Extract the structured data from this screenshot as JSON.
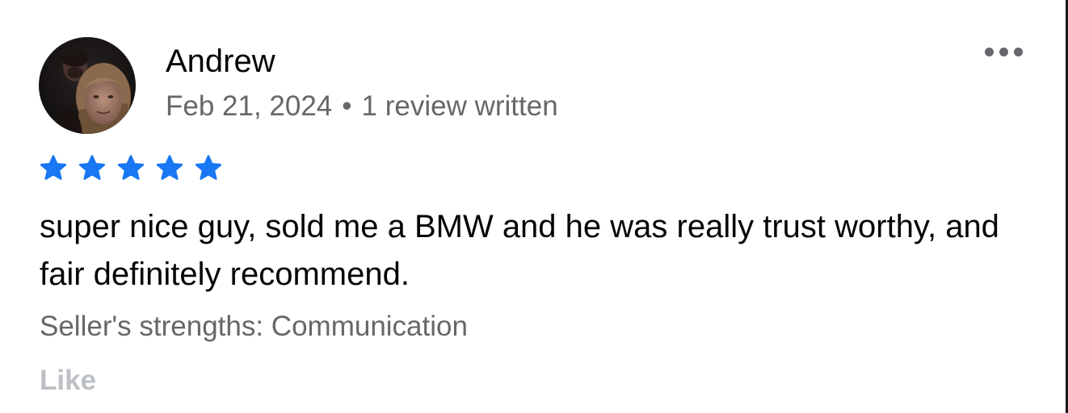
{
  "review": {
    "reviewer_name": "Andrew",
    "date": "Feb 21, 2024",
    "separator": "•",
    "review_count": "1 review written",
    "rating": 5,
    "rating_max": 5,
    "text": "super nice guy, sold me a BMW and he was really trust worthy, and fair definitely recommend.",
    "strengths": "Seller's strengths: Communication",
    "like_label": "Like"
  },
  "icons": {
    "avatar": "profile-photo",
    "more": "more-options-icon",
    "star": "star-icon"
  },
  "colors": {
    "star": "#1877f2",
    "primary_text": "#050505",
    "secondary_text": "#65676b",
    "like_text": "#bcc0c4",
    "background": "#ffffff"
  }
}
